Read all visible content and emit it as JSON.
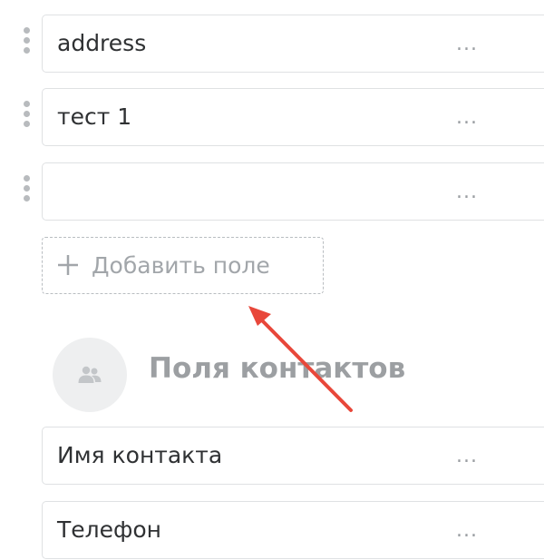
{
  "fields": [
    {
      "value": "address",
      "more": "..."
    },
    {
      "value": "тест 1",
      "more": "..."
    },
    {
      "value": "",
      "more": "..."
    }
  ],
  "add_field": {
    "label": "Добавить поле",
    "icon": "plus-icon"
  },
  "contacts_section": {
    "title": "Поля контактов",
    "icon": "users-icon",
    "fields": [
      {
        "value": "Имя контакта",
        "more": "..."
      },
      {
        "value": "Телефон",
        "more": "..."
      }
    ]
  },
  "annotation": {
    "icon": "arrow-icon",
    "color": "#e8473a"
  }
}
